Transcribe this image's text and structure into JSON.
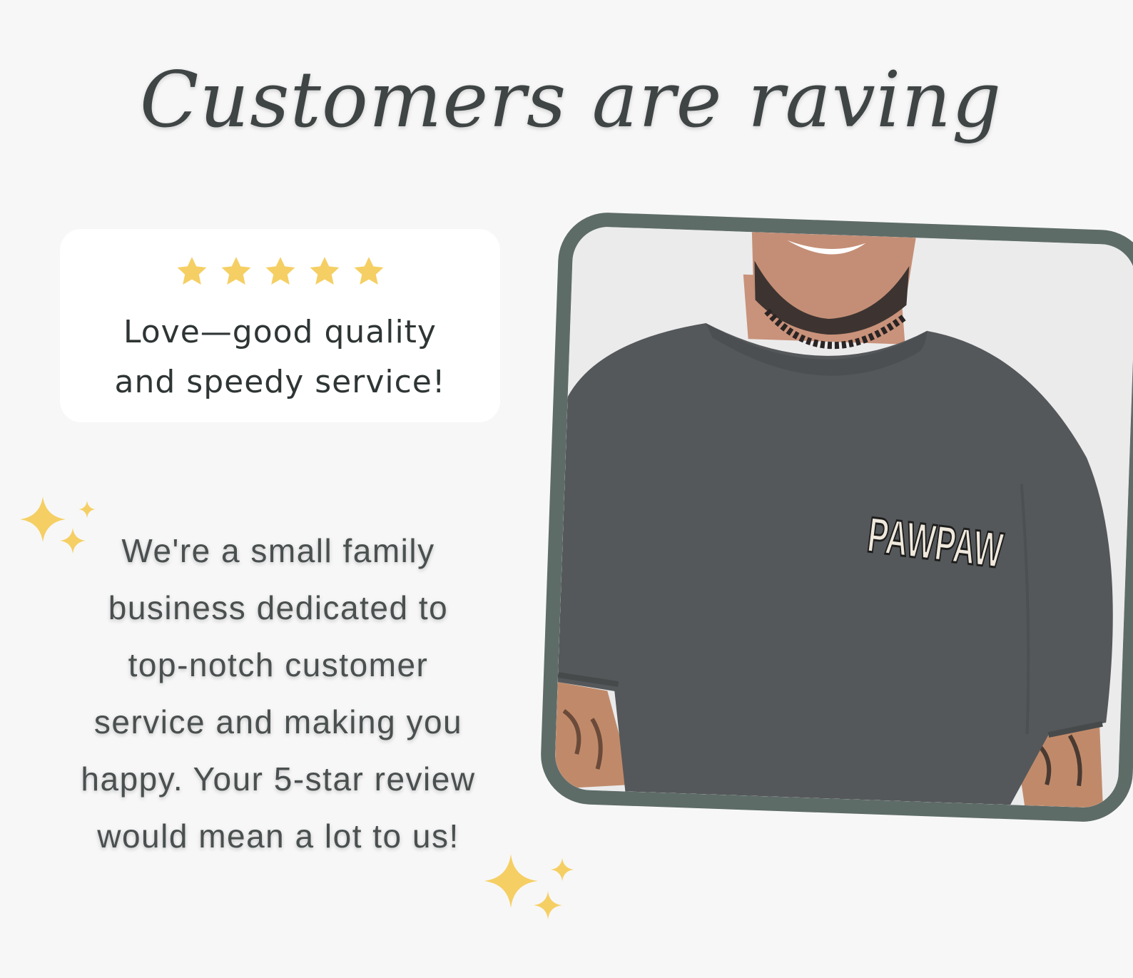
{
  "header": {
    "title": "Customers are raving"
  },
  "review": {
    "rating": 5,
    "rating_max": 5,
    "text_line1": "Love—good quality",
    "text_line2": "and speedy service!"
  },
  "message": {
    "lines": [
      "We're a small family",
      "business dedicated to",
      "top-notch customer",
      "service and making you",
      "happy. Your 5-star review",
      "would mean a lot to us!"
    ]
  },
  "product_photo": {
    "shirt_print": "PAWPAW"
  },
  "colors": {
    "background": "#f7f7f7",
    "star": "#f5cf64",
    "frame": "#5e6c68",
    "text": "#3f4444"
  }
}
